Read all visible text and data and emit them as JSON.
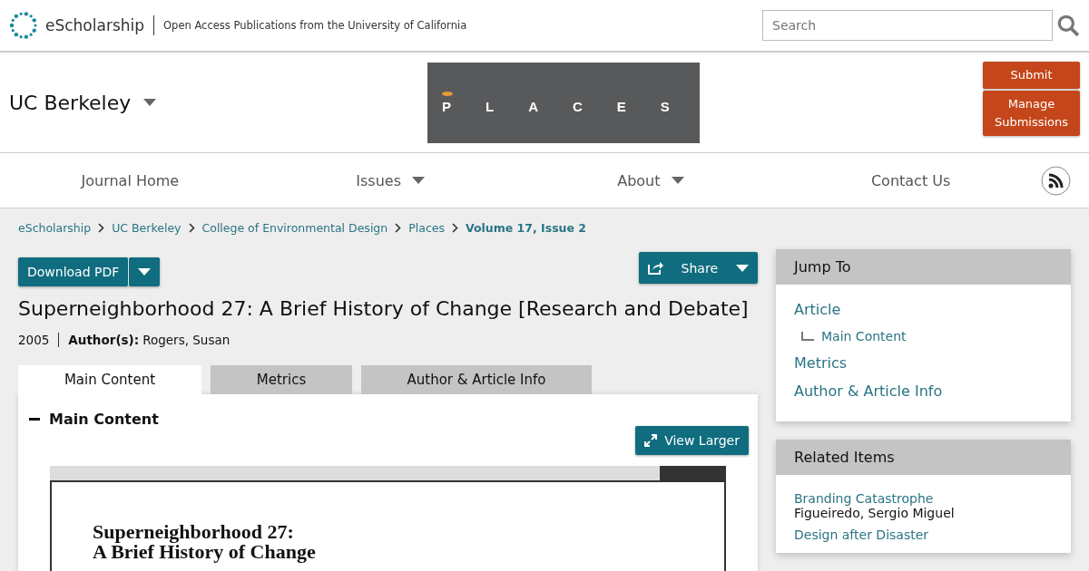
{
  "header": {
    "brand": "eScholarship",
    "tagline": "Open Access Publications from the University of California",
    "search": {
      "placeholder": "Search"
    }
  },
  "campus": {
    "name": "UC Berkeley",
    "journal_logo": "PLACES",
    "buttons": [
      "Submit",
      "Manage Submissions"
    ]
  },
  "nav": [
    {
      "label": "Journal Home",
      "dropdown": false
    },
    {
      "label": "Issues",
      "dropdown": true
    },
    {
      "label": "About",
      "dropdown": true
    },
    {
      "label": "Contact Us",
      "dropdown": false
    }
  ],
  "breadcrumbs": [
    {
      "label": "eScholarship",
      "current": false
    },
    {
      "label": "UC Berkeley",
      "current": false
    },
    {
      "label": "College of Environmental Design",
      "current": false
    },
    {
      "label": "Places",
      "current": false
    },
    {
      "label": "Volume 17, Issue 2",
      "current": true
    }
  ],
  "actions": {
    "download": "Download PDF",
    "share": "Share"
  },
  "article": {
    "title": "Superneighborhood 27: A Brief History of Change [Research and Debate]",
    "year": "2005",
    "authors_label": "Author(s):",
    "authors": "Rogers, Susan"
  },
  "tabs": [
    {
      "label": "Main Content",
      "selected": true
    },
    {
      "label": "Metrics",
      "selected": false
    },
    {
      "label": "Author & Article Info",
      "selected": false
    }
  ],
  "section": {
    "heading": "Main Content",
    "expanded": true,
    "view_larger": "View Larger",
    "document_lines": [
      "Superneighborhood 27:",
      "A Brief History of Change"
    ]
  },
  "jump_to": {
    "heading": "Jump To",
    "items": [
      {
        "label": "Article",
        "children": [
          {
            "label": "Main Content"
          }
        ]
      },
      {
        "label": "Metrics"
      },
      {
        "label": "Author & Article Info"
      }
    ]
  },
  "related": {
    "heading": "Related Items",
    "items": [
      {
        "title": "Branding Catastrophe",
        "author": "Figueiredo, Sergio Miguel"
      },
      {
        "title": "Design after Disaster"
      }
    ]
  }
}
